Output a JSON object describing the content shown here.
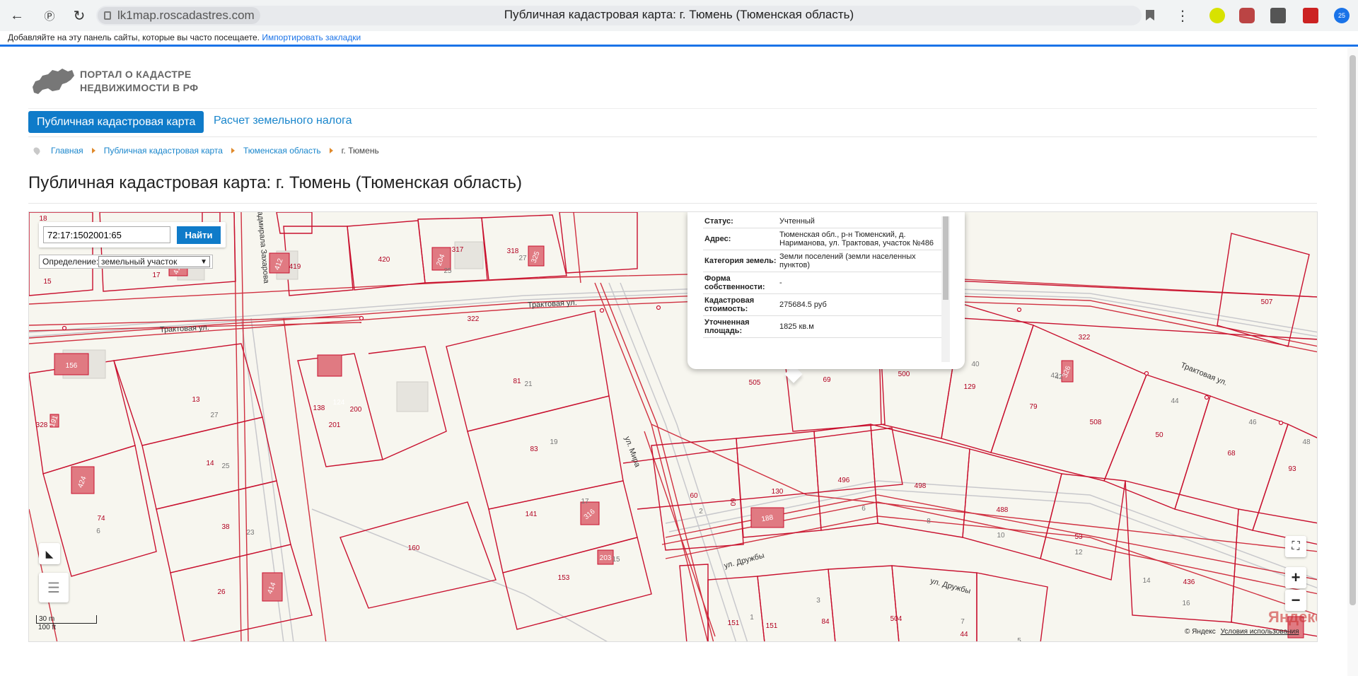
{
  "browser": {
    "url": "lk1map.roscadastres.com",
    "title": "Публичная кадастровая карта: г. Тюмень (Тюменская область)",
    "bookmarks_prompt": "Добавляйте на эту панель сайты, которые вы часто посещаете.",
    "import_link": "Импортировать закладки",
    "ext_badge": "25"
  },
  "portal": {
    "logo_line1": "ПОРТАЛ О КАДАСТРЕ",
    "logo_line2": "НЕДВИЖИМОСТИ В РФ",
    "tab_active": "Публичная кадастровая карта",
    "tab_other": "Расчет земельного налога",
    "breadcrumbs": [
      "Главная",
      "Публичная кадастровая карта",
      "Тюменская область",
      "г. Тюмень"
    ],
    "heading": "Публичная кадастровая карта: г. Тюмень (Тюменская область)"
  },
  "map": {
    "search_value": "72:17:1502001:65",
    "search_button": "Найти",
    "definition_label": "Определение:",
    "definition_value": "земельный участок",
    "popup": {
      "rows": [
        {
          "k": "Статус:",
          "v": "Учтенный"
        },
        {
          "k": "Адрес:",
          "v": "Тюменская обл., р-н Тюменский, д. Нариманова, ул. Трактовая, участок №486"
        },
        {
          "k": "Категория земель:",
          "v": "Земли поселений (земли населенных пунктов)"
        },
        {
          "k": "Форма собственности:",
          "v": "-"
        },
        {
          "k": "Кадастровая стоимость:",
          "v": "275684.5 руб"
        },
        {
          "k": "Уточненная площадь:",
          "v": "1825 кв.м"
        }
      ]
    },
    "scale_m": "30 m",
    "scale_ft": "100 ft",
    "copyright": "© Яндекс",
    "terms": "Условия использования",
    "yandex": "Яндекс",
    "streets": [
      "Трактовая ул.",
      "Трактовая ул.",
      "Трактовая ул.",
      "ул. Мира",
      "ул. Дружбы",
      "ул. Дружбы",
      "адмирала Захарова"
    ],
    "parcel_labels": [
      {
        "t": "18"
      },
      {
        "t": "15"
      },
      {
        "t": "17"
      },
      {
        "t": "419"
      },
      {
        "t": "420"
      },
      {
        "t": "317"
      },
      {
        "t": "318"
      },
      {
        "t": "27"
      },
      {
        "t": "25"
      },
      {
        "t": "322"
      },
      {
        "t": "322"
      },
      {
        "t": "156"
      },
      {
        "t": "328"
      },
      {
        "t": "13"
      },
      {
        "t": "27"
      },
      {
        "t": "138"
      },
      {
        "t": "124"
      },
      {
        "t": "200"
      },
      {
        "t": "201"
      },
      {
        "t": "81"
      },
      {
        "t": "21"
      },
      {
        "t": "14"
      },
      {
        "t": "25"
      },
      {
        "t": "83"
      },
      {
        "t": "19"
      },
      {
        "t": "74"
      },
      {
        "t": "6"
      },
      {
        "t": "38"
      },
      {
        "t": "23"
      },
      {
        "t": "160"
      },
      {
        "t": "141"
      },
      {
        "t": "17"
      },
      {
        "t": "26"
      },
      {
        "t": "153"
      },
      {
        "t": "505"
      },
      {
        "t": "69"
      },
      {
        "t": "500"
      },
      {
        "t": "40"
      },
      {
        "t": "129"
      },
      {
        "t": "42"
      },
      {
        "t": "79"
      },
      {
        "t": "507"
      },
      {
        "t": "44"
      },
      {
        "t": "508"
      },
      {
        "t": "50"
      },
      {
        "t": "46"
      },
      {
        "t": "48"
      },
      {
        "t": "68"
      },
      {
        "t": "93"
      },
      {
        "t": "60"
      },
      {
        "t": "2"
      },
      {
        "t": "60"
      },
      {
        "t": "130"
      },
      {
        "t": "496"
      },
      {
        "t": "6"
      },
      {
        "t": "498"
      },
      {
        "t": "8"
      },
      {
        "t": "488"
      },
      {
        "t": "10"
      },
      {
        "t": "53"
      },
      {
        "t": "12"
      },
      {
        "t": "14"
      },
      {
        "t": "436"
      },
      {
        "t": "16"
      },
      {
        "t": "151"
      },
      {
        "t": "1"
      },
      {
        "t": "151"
      },
      {
        "t": "3"
      },
      {
        "t": "84"
      },
      {
        "t": "504"
      },
      {
        "t": "7"
      },
      {
        "t": "44"
      },
      {
        "t": "5"
      }
    ],
    "building_labels": [
      {
        "t": "412"
      },
      {
        "t": "412"
      },
      {
        "t": "204"
      },
      {
        "t": "325"
      },
      {
        "t": "124"
      },
      {
        "t": "191"
      },
      {
        "t": "424"
      },
      {
        "t": "414"
      },
      {
        "t": "316"
      },
      {
        "t": "203"
      },
      {
        "t": "326"
      },
      {
        "t": "188"
      },
      {
        "t": "15"
      },
      {
        "t": "42"
      }
    ]
  }
}
